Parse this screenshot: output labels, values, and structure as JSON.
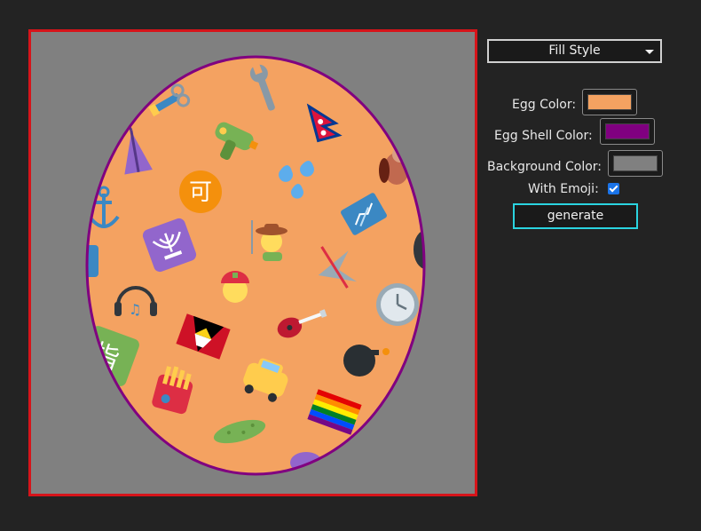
{
  "fill_style_select": {
    "label": "Fill Style"
  },
  "controls": {
    "egg_color_label": "Egg Color:",
    "egg_color_value": "#f4a261",
    "shell_color_label": "Egg Shell Color:",
    "shell_color_value": "#800080",
    "background_color_label": "Background Color:",
    "background_color_value": "#808080",
    "with_emoji_label": "With Emoji:",
    "with_emoji_checked": true,
    "generate_label": "generate"
  },
  "colors": {
    "frame_border": "#d6141a",
    "egg_fill": "#f4a261",
    "egg_shell": "#800080",
    "background": "#808080",
    "accent": "#2ad4e0"
  },
  "emoji": [
    {
      "name": "wrench-icon",
      "glyph": "🔧"
    },
    {
      "name": "scissors-icon",
      "glyph": "✂"
    },
    {
      "name": "water-pistol-icon",
      "glyph": "🔫"
    },
    {
      "name": "nepal-flag-icon",
      "glyph": "🇳🇵"
    },
    {
      "name": "umbrella-icon",
      "glyph": "🌂"
    },
    {
      "name": "droplets-icon",
      "glyph": "💦"
    },
    {
      "name": "chipmunk-icon",
      "glyph": "🐿"
    },
    {
      "name": "acceptable-button-icon",
      "glyph": "🉑"
    },
    {
      "name": "anchor-icon",
      "glyph": "⚓"
    },
    {
      "name": "x-ray-icon",
      "glyph": "🩻"
    },
    {
      "name": "menorah-icon",
      "glyph": "🕎"
    },
    {
      "name": "farmer-icon",
      "glyph": "🧑‍🌾"
    },
    {
      "name": "no-flying-icon",
      "glyph": "✈"
    },
    {
      "name": "headphones-icon",
      "glyph": "🎧"
    },
    {
      "name": "rescue-worker-icon",
      "glyph": "⛑"
    },
    {
      "name": "clock-icon",
      "glyph": "🕒"
    },
    {
      "name": "guitar-icon",
      "glyph": "🎸"
    },
    {
      "name": "antigua-flag-icon",
      "glyph": "🇦🇬"
    },
    {
      "name": "bomb-icon",
      "glyph": "💣"
    },
    {
      "name": "fries-icon",
      "glyph": "🍟"
    },
    {
      "name": "taxi-icon",
      "glyph": "🚖"
    },
    {
      "name": "rainbow-flag-icon",
      "glyph": "🏳‍🌈"
    },
    {
      "name": "pickle-icon",
      "glyph": "🥒"
    },
    {
      "name": "sign-icon",
      "glyph": "🈯"
    }
  ]
}
